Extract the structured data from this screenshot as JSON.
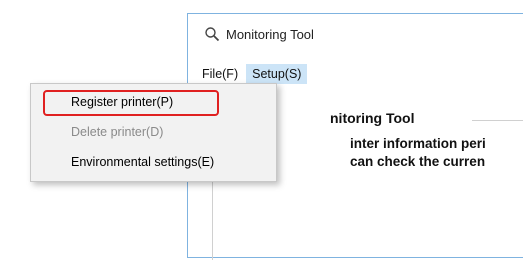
{
  "window": {
    "title": "Monitoring Tool",
    "icon": "magnifier-icon"
  },
  "menubar": {
    "items": [
      {
        "label": "File(F)"
      },
      {
        "label": "Setup(S)",
        "active": true
      }
    ]
  },
  "dropdown": {
    "items": [
      {
        "label": "Register printer(P)",
        "enabled": true,
        "highlighted": true
      },
      {
        "label": "Delete printer(D)",
        "enabled": false
      },
      {
        "label": "Environmental settings(E)",
        "enabled": true
      }
    ]
  },
  "content": {
    "group_title": "nitoring Tool",
    "description_line1": "inter information peri",
    "description_line2": "can check the curren"
  },
  "colors": {
    "highlight_border": "#e02020",
    "active_menu_bg": "#cce4f7",
    "window_border": "#7fb3e0"
  }
}
